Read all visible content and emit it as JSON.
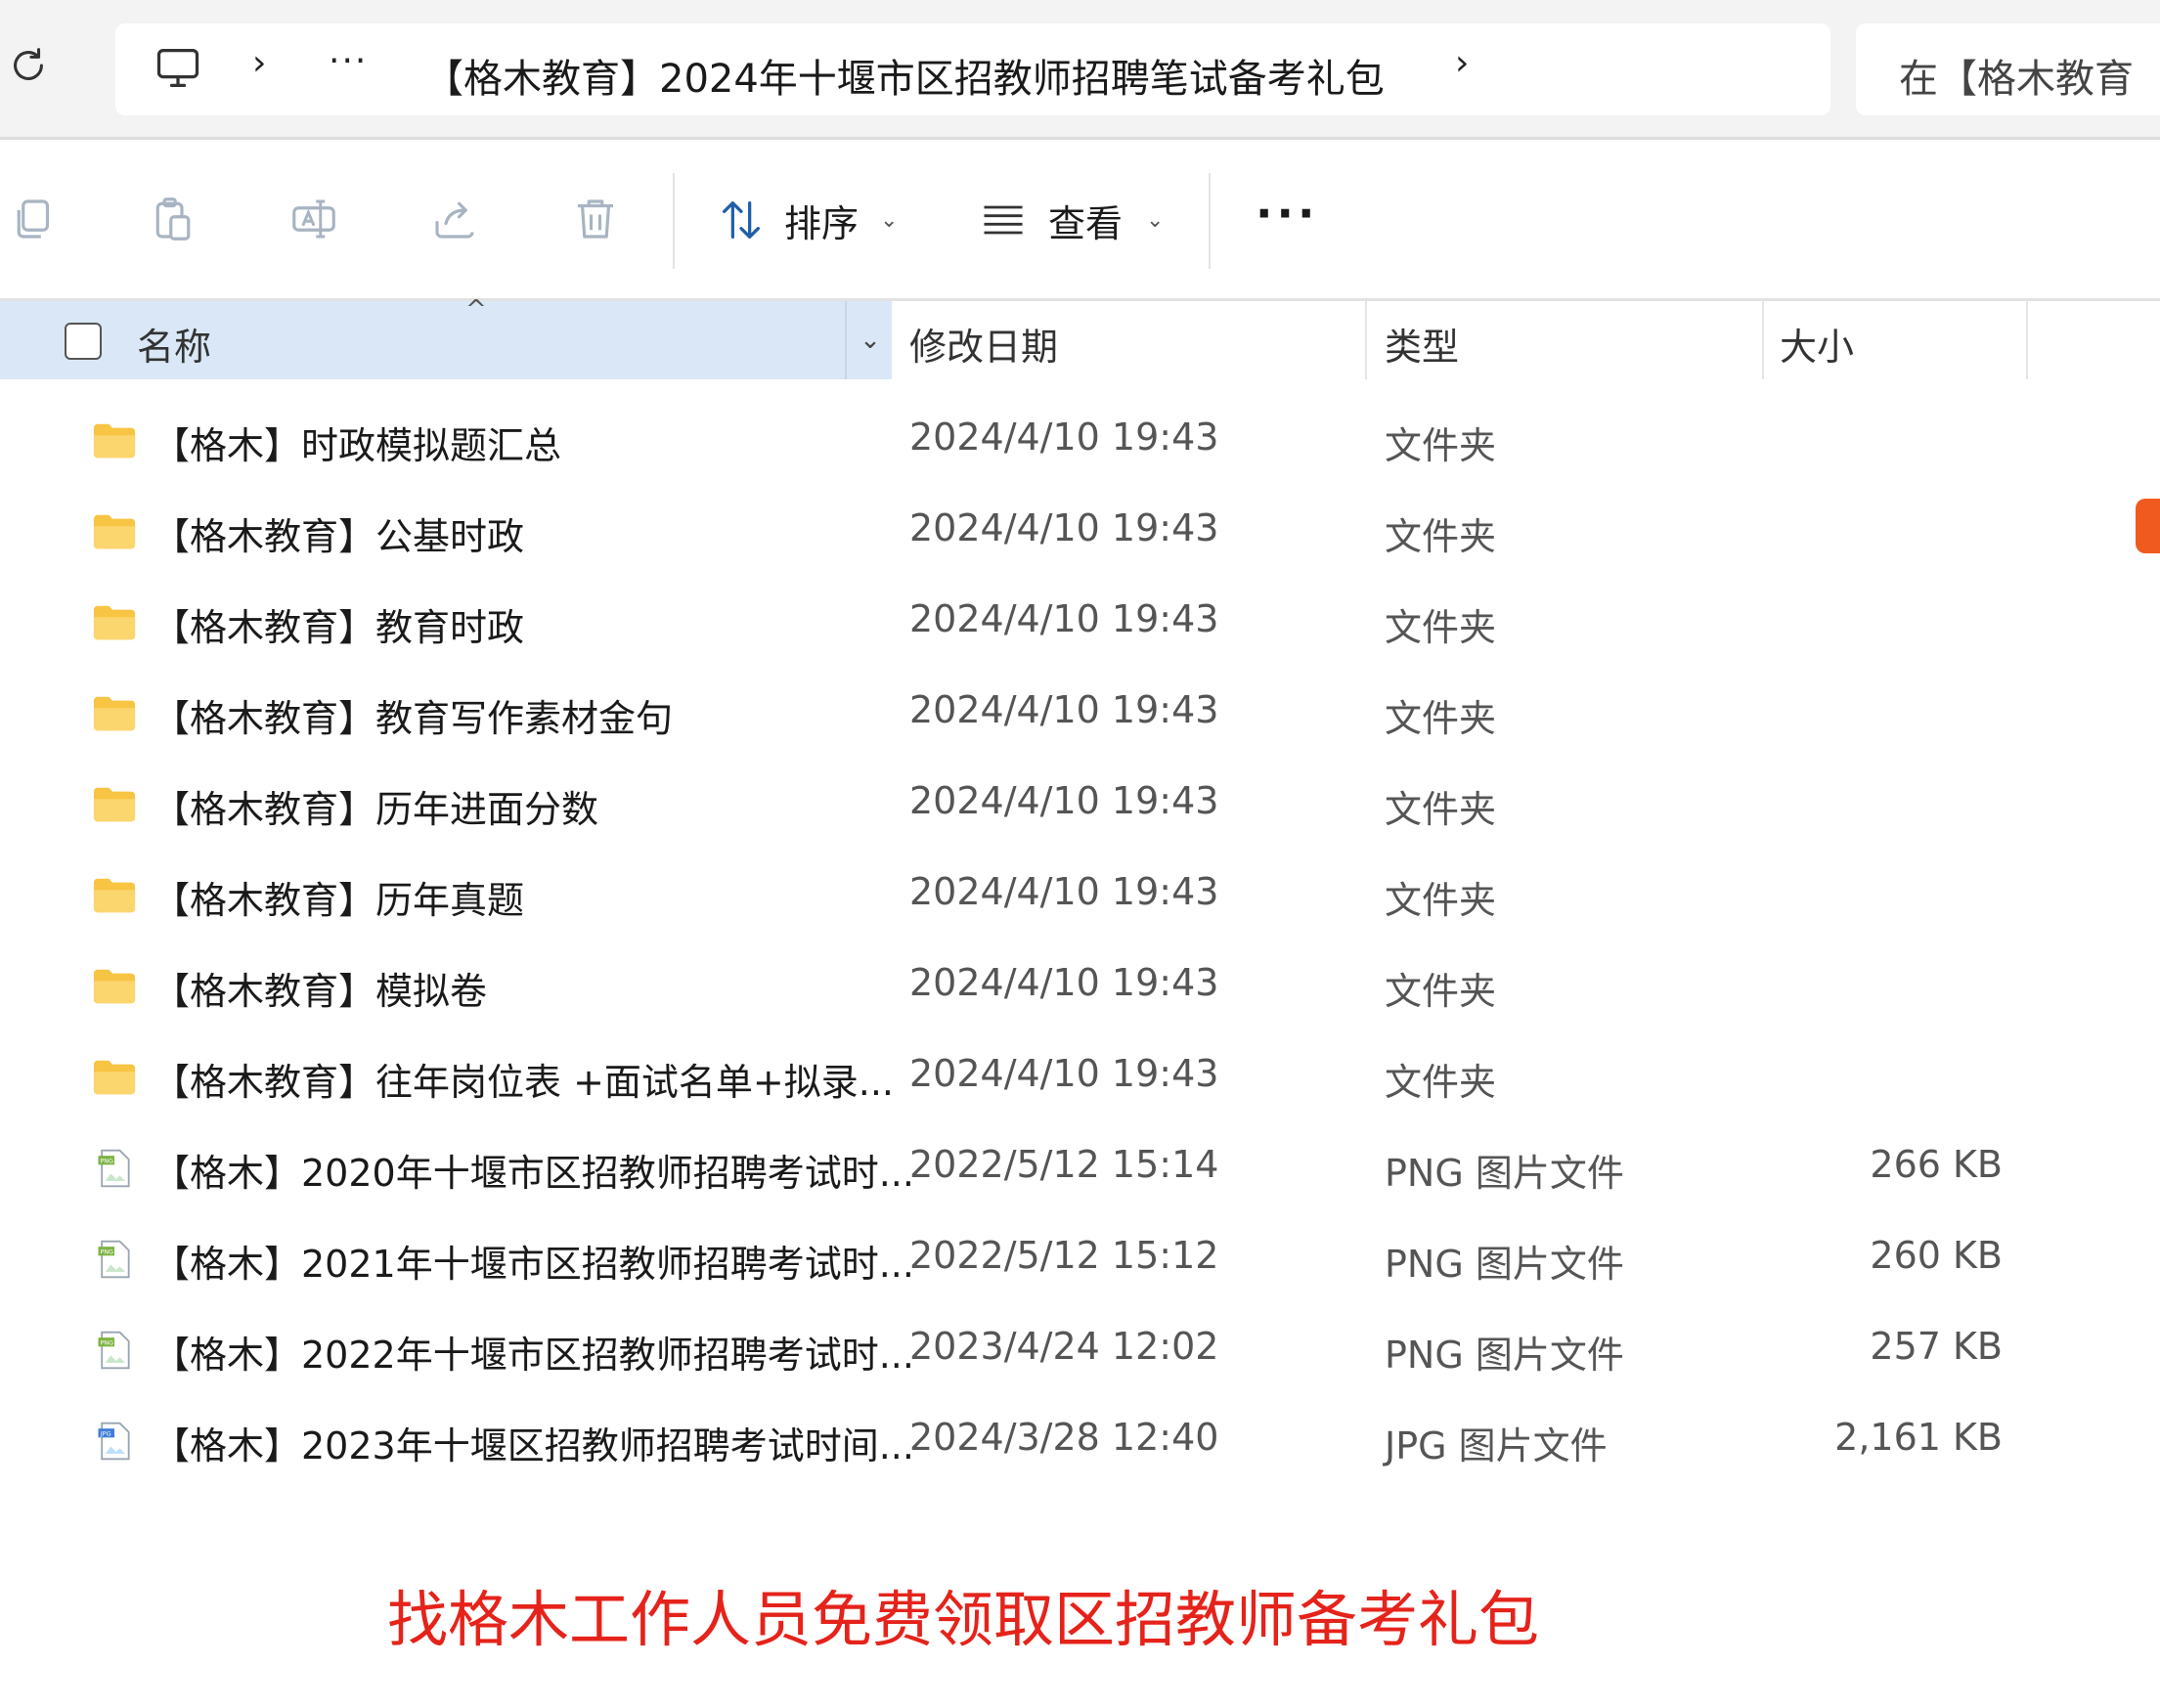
{
  "address": {
    "breadcrumb_more": "···",
    "path": "【格木教育】2024年十堰市区招教师招聘笔试备考礼包",
    "search_placeholder": "在【格木教育"
  },
  "toolbar": {
    "sort_label": "排序",
    "view_label": "查看",
    "more_label": "···"
  },
  "columns": {
    "name": "名称",
    "date": "修改日期",
    "type": "类型",
    "size": "大小"
  },
  "files": [
    {
      "name": "【格木】时政模拟题汇总",
      "date": "2024/4/10 19:43",
      "type": "文件夹",
      "size": "",
      "icon": "folder"
    },
    {
      "name": "【格木教育】公基时政",
      "date": "2024/4/10 19:43",
      "type": "文件夹",
      "size": "",
      "icon": "folder"
    },
    {
      "name": "【格木教育】教育时政",
      "date": "2024/4/10 19:43",
      "type": "文件夹",
      "size": "",
      "icon": "folder"
    },
    {
      "name": "【格木教育】教育写作素材金句",
      "date": "2024/4/10 19:43",
      "type": "文件夹",
      "size": "",
      "icon": "folder"
    },
    {
      "name": "【格木教育】历年进面分数",
      "date": "2024/4/10 19:43",
      "type": "文件夹",
      "size": "",
      "icon": "folder"
    },
    {
      "name": "【格木教育】历年真题",
      "date": "2024/4/10 19:43",
      "type": "文件夹",
      "size": "",
      "icon": "folder"
    },
    {
      "name": "【格木教育】模拟卷",
      "date": "2024/4/10 19:43",
      "type": "文件夹",
      "size": "",
      "icon": "folder"
    },
    {
      "name": "【格木教育】往年岗位表 +面试名单+拟录...",
      "date": "2024/4/10 19:43",
      "type": "文件夹",
      "size": "",
      "icon": "folder"
    },
    {
      "name": "【格木】2020年十堰市区招教师招聘考试时...",
      "date": "2022/5/12 15:14",
      "type": "PNG 图片文件",
      "size": "266 KB",
      "icon": "png-file"
    },
    {
      "name": "【格木】2021年十堰市区招教师招聘考试时...",
      "date": "2022/5/12 15:12",
      "type": "PNG 图片文件",
      "size": "260 KB",
      "icon": "png-file"
    },
    {
      "name": "【格木】2022年十堰市区招教师招聘考试时...",
      "date": "2023/4/24 12:02",
      "type": "PNG 图片文件",
      "size": "257 KB",
      "icon": "png-file"
    },
    {
      "name": "【格木】2023年十堰区招教师招聘考试时间...",
      "date": "2024/3/28 12:40",
      "type": "JPG 图片文件",
      "size": "2,161 KB",
      "icon": "jpg-file"
    }
  ],
  "banner": "找格木工作人员免费领取区招教师备考礼包",
  "colors": {
    "header_selected_bg": "#d9e7f6",
    "folder_yellow": "#f8c443",
    "banner_red": "#e5231b",
    "side_badge": "#f05a1f"
  }
}
